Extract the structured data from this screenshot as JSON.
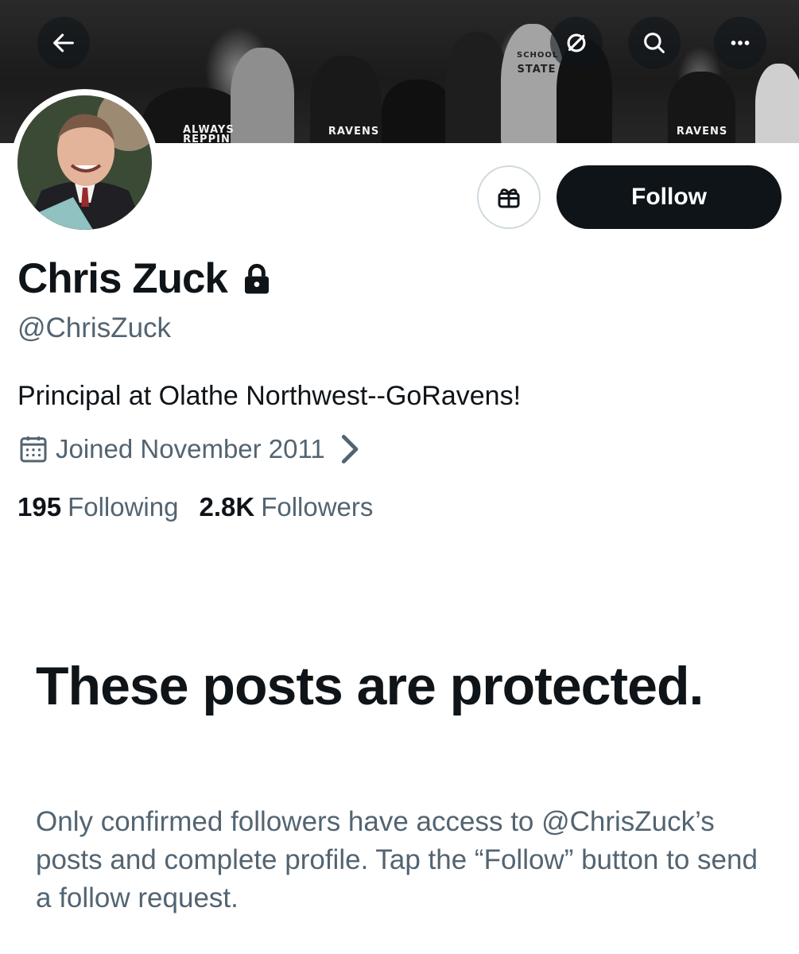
{
  "banner": {
    "shirt_texts": [
      "ALWAYS REPPIN",
      "RAVENS",
      "RAVENS",
      "STATE",
      "SCHOOL"
    ]
  },
  "header": {
    "back_icon": "arrow-left-icon",
    "buttons": [
      "circle-slash-icon",
      "search-icon",
      "more-icon"
    ]
  },
  "profile": {
    "display_name": "Chris Zuck",
    "handle": "@ChrisZuck",
    "bio": "Principal at Olathe Northwest--GoRavens!",
    "joined": "Joined November 2011",
    "following_count": "195",
    "following_label": "Following",
    "followers_count": "2.8K",
    "followers_label": "Followers",
    "follow_label": "Follow",
    "gift_icon": "gift-icon"
  },
  "protected": {
    "title": "These posts are protected.",
    "body": "Only confirmed followers have access to @ChrisZuck’s posts and complete profile. Tap the “Follow” button to send a follow request."
  },
  "colors": {
    "primary_text": "#0f1419",
    "secondary_text": "#536471",
    "follow_bg": "#0f1419",
    "border": "#cfd9de"
  }
}
